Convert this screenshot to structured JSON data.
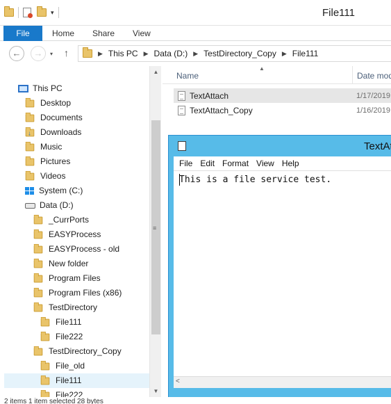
{
  "window": {
    "title": "File111"
  },
  "ribbon": {
    "tabs": [
      "File",
      "Home",
      "Share",
      "View"
    ]
  },
  "nav": {
    "back": "←",
    "forward": "→",
    "up": "↑"
  },
  "address": {
    "crumbs": [
      "This PC",
      "Data (D:)",
      "TestDirectory_Copy",
      "File111"
    ]
  },
  "tree": {
    "this_pc": "This PC",
    "items": [
      {
        "label": "Desktop"
      },
      {
        "label": "Documents"
      },
      {
        "label": "Downloads"
      },
      {
        "label": "Music"
      },
      {
        "label": "Pictures"
      },
      {
        "label": "Videos"
      },
      {
        "label": "System (C:)"
      },
      {
        "label": "Data (D:)"
      },
      {
        "label": "_CurrPorts"
      },
      {
        "label": "EASYProcess"
      },
      {
        "label": "EASYProcess - old"
      },
      {
        "label": "New folder"
      },
      {
        "label": "Program Files"
      },
      {
        "label": "Program Files (x86)"
      },
      {
        "label": "TestDirectory"
      },
      {
        "label": "File111"
      },
      {
        "label": "File222"
      },
      {
        "label": "TestDirectory_Copy"
      },
      {
        "label": "File_old"
      },
      {
        "label": "File111"
      },
      {
        "label": "File222"
      }
    ],
    "selected": "File111"
  },
  "filelist": {
    "columns": {
      "name": "Name",
      "date": "Date mod"
    },
    "rows": [
      {
        "name": "TextAttach",
        "date": "1/17/2019"
      },
      {
        "name": "TextAttach_Copy",
        "date": "1/16/2019"
      }
    ]
  },
  "notepad": {
    "title": "TextAt",
    "menu": [
      "File",
      "Edit",
      "Format",
      "View",
      "Help"
    ],
    "content": "This is a file service test."
  },
  "status": {
    "text": "2 items    1 item selected    28 bytes"
  },
  "colors": {
    "accent": "#1979ca",
    "notepad_frame": "#57bbe8",
    "selection": "#e5f3fb"
  }
}
